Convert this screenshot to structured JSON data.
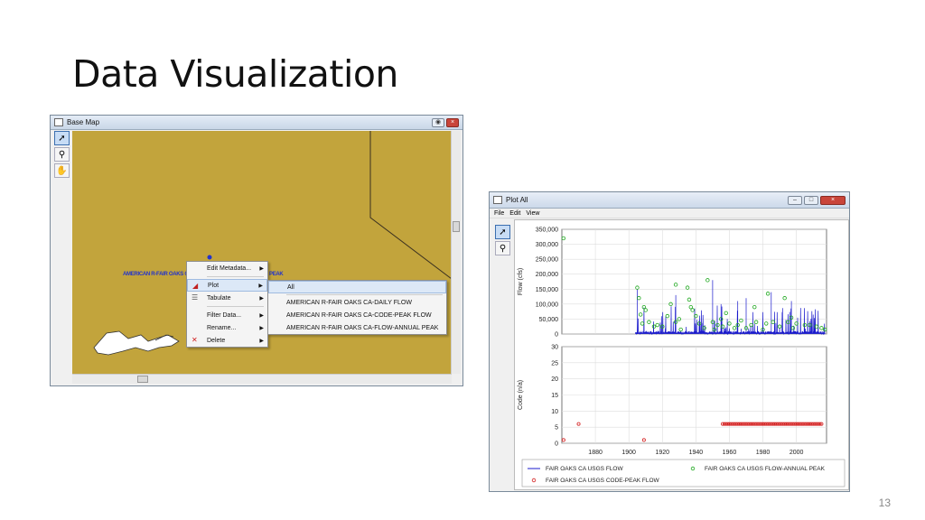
{
  "slide": {
    "title": "Data Visualization",
    "page_number": "13"
  },
  "base_map": {
    "title": "Base Map",
    "tools": [
      {
        "name": "pointer-tool",
        "glyph": "➚"
      },
      {
        "name": "zoom-tool",
        "glyph": "⚲"
      },
      {
        "name": "pan-tool",
        "glyph": "✋"
      }
    ],
    "map_label_left": "AMERICAN R-FAIR OAKS CA",
    "map_label_right": "PEAK",
    "context_menu": [
      {
        "label": "Edit Metadata...",
        "icon": "",
        "has_submenu": true
      },
      {
        "label": "Plot",
        "icon": "plot-icon",
        "has_submenu": true,
        "highlighted": true
      },
      {
        "label": "Tabulate",
        "icon": "table-icon",
        "has_submenu": true
      },
      {
        "label": "Filter Data...",
        "icon": "",
        "has_submenu": true
      },
      {
        "label": "Rename...",
        "icon": "",
        "has_submenu": true
      },
      {
        "label": "Delete",
        "icon": "delete-icon",
        "has_submenu": true
      }
    ],
    "submenu": [
      "All",
      "AMERICAN R-FAIR OAKS CA-DAILY FLOW",
      "AMERICAN R-FAIR OAKS CA-CODE-PEAK FLOW",
      "AMERICAN R-FAIR OAKS CA-FLOW-ANNUAL PEAK"
    ]
  },
  "plot_all": {
    "title": "Plot All",
    "menu": [
      "File",
      "Edit",
      "View"
    ],
    "colors": {
      "flow": "#1a1acc",
      "annual_peak": "#1fa81f",
      "code_peak": "#d42020"
    }
  },
  "chart_data": [
    {
      "type": "line",
      "ylabel": "Flow (cfs)",
      "ylim": [
        0,
        350000
      ],
      "yticks": [
        "350,000",
        "300,000",
        "250,000",
        "200,000",
        "150,000",
        "100,000",
        "50,000",
        "0"
      ],
      "xlim": [
        1860,
        2018
      ],
      "grid": true,
      "series": [
        {
          "name": "FAIR OAKS CA USGS FLOW",
          "kind": "line",
          "color": "#1a1acc"
        },
        {
          "name": "FAIR OAKS CA USGS FLOW-ANNUAL PEAK",
          "kind": "scatter",
          "color": "#1fa81f",
          "x": [
            1861,
            1905,
            1906,
            1907,
            1908,
            1909,
            1910,
            1912,
            1915,
            1917,
            1920,
            1923,
            1925,
            1928,
            1928,
            1930,
            1931,
            1935,
            1936,
            1937,
            1938,
            1940,
            1942,
            1945,
            1947,
            1950,
            1951,
            1953,
            1955,
            1956,
            1958,
            1960,
            1963,
            1965,
            1967,
            1970,
            1973,
            1975,
            1976,
            1980,
            1982,
            1983,
            1986,
            1990,
            1993,
            1995,
            1997,
            1998,
            2000,
            2005,
            2008,
            2012,
            2015,
            2017
          ],
          "y": [
            320000,
            155000,
            120000,
            65000,
            35000,
            90000,
            80000,
            40000,
            25000,
            30000,
            25000,
            60000,
            100000,
            165000,
            40000,
            50000,
            15000,
            155000,
            115000,
            90000,
            80000,
            60000,
            35000,
            20000,
            180000,
            40000,
            15000,
            30000,
            50000,
            25000,
            70000,
            35000,
            20000,
            30000,
            45000,
            20000,
            30000,
            90000,
            40000,
            15000,
            35000,
            135000,
            40000,
            25000,
            120000,
            40000,
            55000,
            20000,
            35000,
            30000,
            30000,
            25000,
            20000,
            15000
          ]
        }
      ]
    },
    {
      "type": "scatter",
      "ylabel": "Code (n/a)",
      "ylim": [
        0,
        30
      ],
      "yticks": [
        "30",
        "25",
        "20",
        "15",
        "10",
        "5",
        "0"
      ],
      "xlim": [
        1860,
        2018
      ],
      "xticks": [
        "1880",
        "1900",
        "1920",
        "1940",
        "1960",
        "1980",
        "2000"
      ],
      "grid": true,
      "series": [
        {
          "name": "FAIR OAKS CA USGS CODE-PEAK FLOW",
          "kind": "scatter",
          "color": "#d42020",
          "x": [
            1861,
            1870,
            1909,
            1956,
            1957,
            1958,
            1959,
            1960,
            1961,
            1962,
            1963,
            1964,
            1965,
            1966,
            1967,
            1968,
            1969,
            1970,
            1971,
            1972,
            1973,
            1974,
            1975,
            1976,
            1977,
            1978,
            1979,
            1980,
            1981,
            1982,
            1983,
            1984,
            1985,
            1986,
            1987,
            1988,
            1989,
            1990,
            1991,
            1992,
            1993,
            1994,
            1995,
            1996,
            1997,
            1998,
            1999,
            2000,
            2001,
            2002,
            2003,
            2004,
            2005,
            2006,
            2007,
            2008,
            2009,
            2010,
            2011,
            2012,
            2013,
            2014,
            2015
          ],
          "y": [
            1,
            6,
            1,
            6,
            6,
            6,
            6,
            6,
            6,
            6,
            6,
            6,
            6,
            6,
            6,
            6,
            6,
            6,
            6,
            6,
            6,
            6,
            6,
            6,
            6,
            6,
            6,
            6,
            6,
            6,
            6,
            6,
            6,
            6,
            6,
            6,
            6,
            6,
            6,
            6,
            6,
            6,
            6,
            6,
            6,
            6,
            6,
            6,
            6,
            6,
            6,
            6,
            6,
            6,
            6,
            6,
            6,
            6,
            6,
            6,
            6,
            6,
            6
          ]
        }
      ]
    }
  ],
  "legend": [
    {
      "label": "FAIR OAKS CA USGS FLOW",
      "marker": "line",
      "color": "#1a1acc"
    },
    {
      "label": "FAIR OAKS CA USGS FLOW-ANNUAL PEAK",
      "marker": "circle",
      "color": "#1fa81f"
    },
    {
      "label": "FAIR OAKS CA USGS CODE-PEAK FLOW",
      "marker": "circle",
      "color": "#d42020"
    }
  ]
}
